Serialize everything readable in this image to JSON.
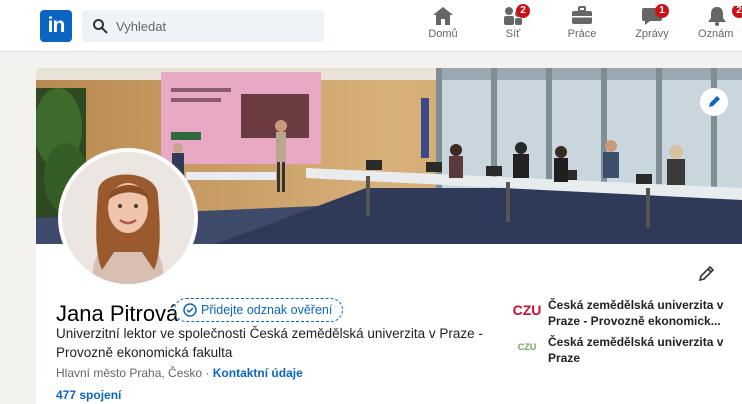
{
  "header": {
    "logo_text": "in",
    "search": {
      "placeholder": "Vyhledat"
    },
    "nav": [
      {
        "label": "Domů",
        "icon": "home-icon",
        "badge": ""
      },
      {
        "label": "Síť",
        "icon": "network-icon",
        "badge": "2"
      },
      {
        "label": "Práce",
        "icon": "briefcase-icon",
        "badge": ""
      },
      {
        "label": "Zprávy",
        "icon": "messaging-icon",
        "badge": "1"
      },
      {
        "label": "Oznám",
        "icon": "bell-icon",
        "badge": "2"
      }
    ]
  },
  "profile": {
    "name": "Jana Pitrová",
    "verify_badge": "Přidejte odznak ověření",
    "headline": "Univerzitní lektor ve společnosti Česká zemědělská univerzita v Praze - Provozně ekonomická fakulta",
    "location": "Hlavní město Praha, Česko",
    "location_separator": "·",
    "contact_link": "Kontaktní údaje",
    "connections": "477 spojení",
    "organizations": [
      {
        "logo_text": "CZU",
        "name": "Česká zemědělská univerzita v Praze - Provozně ekonomick...",
        "logo_color": "#c8102e"
      },
      {
        "logo_text": "CZU",
        "name": "Česká zemědělská univerzita v Praze",
        "logo_color": "#6aa84f"
      }
    ]
  },
  "colors": {
    "brand": "#0a66c2",
    "badge": "#cc1016"
  }
}
